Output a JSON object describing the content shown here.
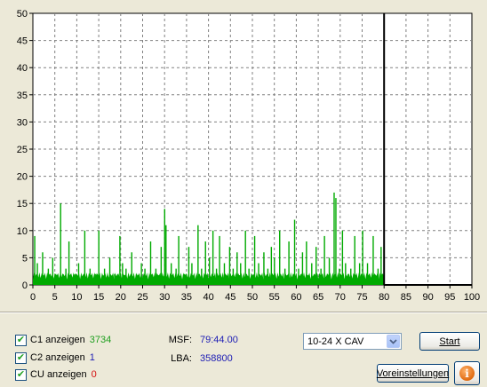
{
  "chart_data": {
    "type": "bar",
    "title": "",
    "xlabel": "",
    "ylabel": "",
    "xlim": [
      0,
      100
    ],
    "ylim": [
      0,
      50
    ],
    "x_ticks": [
      "0",
      "5",
      "10",
      "15",
      "20",
      "25",
      "30",
      "35",
      "40",
      "45",
      "50",
      "55",
      "60",
      "65",
      "70",
      "75",
      "80",
      "85",
      "90",
      "95",
      "100"
    ],
    "y_ticks": [
      "0",
      "5",
      "10",
      "15",
      "20",
      "25",
      "30",
      "35",
      "40",
      "45",
      "50"
    ],
    "grid": true,
    "bar_color": "#00aa00",
    "marker_x": 80,
    "series": [
      {
        "name": "C1",
        "x": [
          0.4,
          1.0,
          2.2,
          3.5,
          4.5,
          5.2,
          6.3,
          7.5,
          8.2,
          9.5,
          10.4,
          11.8,
          13.0,
          14.2,
          15.0,
          16.3,
          17.5,
          18.6,
          19.8,
          20.4,
          21.2,
          22.5,
          23.6,
          24.7,
          25.5,
          26.8,
          28.0,
          29.2,
          30.0,
          30.3,
          31.5,
          32.6,
          33.2,
          34.5,
          35.5,
          36.2,
          37.6,
          38.4,
          39.3,
          40.2,
          41.0,
          41.8,
          42.5,
          43.6,
          44.8,
          45.6,
          46.5,
          47.3,
          48.4,
          49.2,
          50.5,
          51.4,
          52.6,
          53.5,
          54.3,
          55.0,
          56.2,
          57.4,
          58.3,
          59.6,
          60.5,
          61.4,
          62.3,
          63.5,
          64.5,
          65.6,
          66.4,
          67.5,
          68.6,
          69.0,
          69.8,
          70.5,
          71.2,
          72.4,
          73.3,
          74.4,
          75.1,
          76.2,
          77.5,
          78.6,
          79.3
        ],
        "values": [
          9,
          4,
          6,
          3,
          5,
          2,
          15,
          3,
          8,
          2,
          4,
          10,
          3,
          2,
          10,
          3,
          5,
          2,
          9,
          4,
          3,
          6,
          2,
          4,
          3,
          8,
          3,
          7,
          14,
          11,
          4,
          3,
          9,
          2,
          7,
          4,
          11,
          3,
          8,
          5,
          10,
          3,
          9,
          4,
          7,
          3,
          6,
          4,
          10,
          3,
          9,
          4,
          6,
          3,
          7,
          5,
          10,
          3,
          8,
          12,
          3,
          6,
          8,
          4,
          7,
          3,
          9,
          5,
          17,
          16,
          3,
          10,
          4,
          3,
          9,
          4,
          10,
          4,
          9,
          3,
          7
        ]
      }
    ]
  },
  "checks": {
    "c1": {
      "label": "C1 anzeigen",
      "count": "3734",
      "color": "#1e9e1e"
    },
    "c2": {
      "label": "C2 anzeigen",
      "count": "1",
      "color": "#1c1cb4"
    },
    "cu": {
      "label": "CU anzeigen",
      "count": "0",
      "color": "#d41010"
    }
  },
  "info": {
    "msf_label": "MSF:",
    "msf_value": "79:44.00",
    "lba_label": "LBA:",
    "lba_value": "358800"
  },
  "speed": {
    "selected": "10-24 X CAV"
  },
  "buttons": {
    "start": "Start",
    "settings": "Voreinstellungen"
  },
  "icons": {
    "dropdown": "chevron-down-icon",
    "info": "info-icon"
  }
}
